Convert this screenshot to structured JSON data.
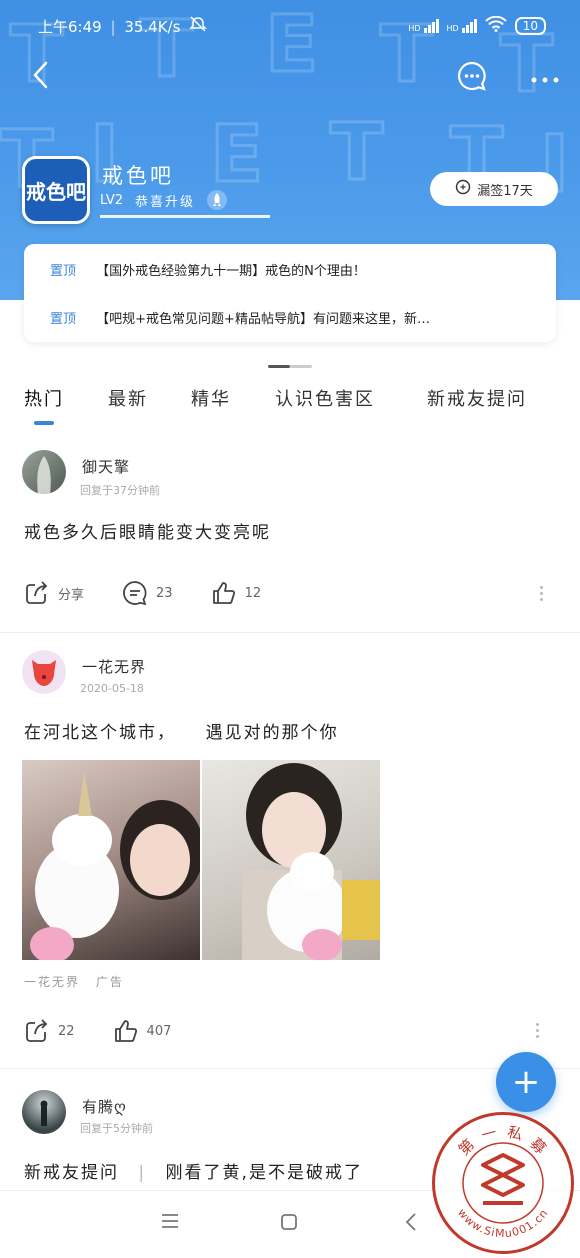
{
  "status_bar": {
    "time": "上午6:49",
    "speed": "35.4K/s",
    "network_1": "HD",
    "network_2": "HD",
    "battery": "10"
  },
  "forum": {
    "name": "戒色吧",
    "logo_text": "戒色吧",
    "level": "LV2",
    "level_text": "恭喜升级",
    "level_progress": 1.0
  },
  "signin": {
    "label": "漏签17天"
  },
  "pinned": [
    {
      "tag": "置顶",
      "title": "【国外戒色经验第九十一期】戒色的N个理由！"
    },
    {
      "tag": "置顶",
      "title": "【吧规+戒色常见问题+精品帖导航】有问题来这里，新…"
    }
  ],
  "tabs": [
    "热门",
    "最新",
    "精华",
    "认识色害区",
    "新戒友提问"
  ],
  "posts": [
    {
      "author": "御天擎",
      "meta": "回复于37分钟前",
      "title": "戒色多久后眼睛能变大变亮呢",
      "share_label": "分享",
      "comments": "23",
      "likes": "12"
    },
    {
      "author": "一花无界",
      "meta": "2020-05-18",
      "title": "在河北这个城市，    遇见对的那个你",
      "ad_author": "一花无界",
      "ad_label": "广告",
      "shares": "22",
      "likes": "407"
    },
    {
      "author": "有腾ღ",
      "meta": "回复于5分钟前",
      "tag": "新戒友提问",
      "title": "刚看了黄,是不是破戒了"
    }
  ],
  "fab": {
    "label": "+"
  },
  "watermark": {
    "text_top": "第 一 私 募",
    "text_bottom": "www.SiMu001.cn"
  },
  "colors": {
    "header": "#4b9aea",
    "accent": "#3a86d8",
    "seal": "#c0392b"
  }
}
